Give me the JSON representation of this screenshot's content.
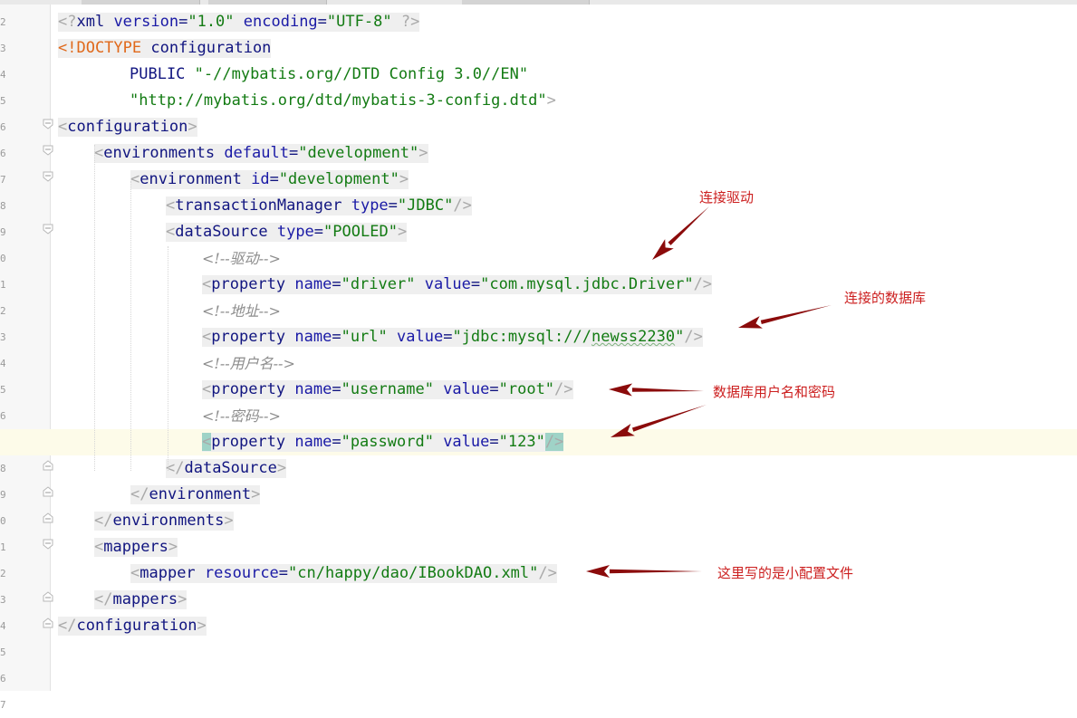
{
  "editor": {
    "lines": [
      {
        "segs": [
          [
            "brk",
            "<?"
          ],
          [
            "nm",
            "xml "
          ],
          [
            "at",
            "version"
          ],
          [
            "eq",
            "="
          ],
          [
            "st",
            "\"1.0\""
          ],
          [
            "pl",
            " "
          ],
          [
            "at",
            "encoding"
          ],
          [
            "eq",
            "="
          ],
          [
            "st",
            "\"UTF-8\""
          ],
          [
            "pl",
            " "
          ],
          [
            "brk",
            "?>"
          ]
        ]
      },
      {
        "segs": [
          [
            "kw",
            "<!DOCTYPE "
          ],
          [
            "nm",
            "configuration"
          ]
        ]
      },
      {
        "segs": [
          [
            "pl",
            "PUBLIC "
          ],
          [
            "st",
            "\"-//mybatis.org//DTD Config 3.0//EN\""
          ]
        ]
      },
      {
        "segs": [
          [
            "st",
            "\"http://mybatis.org/dtd/mybatis-3-config.dtd\""
          ],
          [
            "brk",
            ">"
          ]
        ]
      },
      {
        "segs": [
          [
            "brk",
            "<"
          ],
          [
            "nm",
            "configuration"
          ],
          [
            "brk",
            ">"
          ]
        ]
      },
      {
        "segs": [
          [
            "brk",
            "<"
          ],
          [
            "nm",
            "environments "
          ],
          [
            "at",
            "default"
          ],
          [
            "eq",
            "="
          ],
          [
            "st",
            "\"development\""
          ],
          [
            "brk",
            ">"
          ]
        ]
      },
      {
        "segs": [
          [
            "brk",
            "<"
          ],
          [
            "nm",
            "environment "
          ],
          [
            "at",
            "id"
          ],
          [
            "eq",
            "="
          ],
          [
            "st",
            "\"development\""
          ],
          [
            "brk",
            ">"
          ]
        ]
      },
      {
        "segs": [
          [
            "brk",
            "<"
          ],
          [
            "nm",
            "transactionManager "
          ],
          [
            "at",
            "type"
          ],
          [
            "eq",
            "="
          ],
          [
            "st",
            "\"JDBC\""
          ],
          [
            "brk",
            "/>"
          ]
        ]
      },
      {
        "segs": [
          [
            "brk",
            "<"
          ],
          [
            "nm",
            "dataSource "
          ],
          [
            "at",
            "type"
          ],
          [
            "eq",
            "="
          ],
          [
            "st",
            "\"POOLED\""
          ],
          [
            "brk",
            ">"
          ]
        ]
      },
      {
        "segs": [
          [
            "cm",
            "<!--驱动-->"
          ]
        ]
      },
      {
        "segs": [
          [
            "brk",
            "<"
          ],
          [
            "nm",
            "property "
          ],
          [
            "at",
            "name"
          ],
          [
            "eq",
            "="
          ],
          [
            "st",
            "\"driver\""
          ],
          [
            "pl",
            " "
          ],
          [
            "at",
            "value"
          ],
          [
            "eq",
            "="
          ],
          [
            "st",
            "\"com.mysql.jdbc.Driver\""
          ],
          [
            "brk",
            "/>"
          ]
        ]
      },
      {
        "segs": [
          [
            "cm",
            "<!--地址-->"
          ]
        ]
      },
      {
        "segs": [
          [
            "brk",
            "<"
          ],
          [
            "nm",
            "property "
          ],
          [
            "at",
            "name"
          ],
          [
            "eq",
            "="
          ],
          [
            "st",
            "\"url\""
          ],
          [
            "pl",
            " "
          ],
          [
            "at",
            "value"
          ],
          [
            "eq",
            "="
          ],
          [
            "st",
            "\"jdbc:mysql:///"
          ],
          [
            "st sq",
            "newss2230"
          ],
          [
            "st",
            "\""
          ],
          [
            "brk",
            "/>"
          ]
        ]
      },
      {
        "segs": [
          [
            "cm",
            "<!--用户名-->"
          ]
        ]
      },
      {
        "segs": [
          [
            "brk",
            "<"
          ],
          [
            "nm",
            "property "
          ],
          [
            "at",
            "name"
          ],
          [
            "eq",
            "="
          ],
          [
            "st",
            "\"username\""
          ],
          [
            "pl",
            " "
          ],
          [
            "at",
            "value"
          ],
          [
            "eq",
            "="
          ],
          [
            "st",
            "\"root\""
          ],
          [
            "brk",
            "/>"
          ]
        ]
      },
      {
        "segs": [
          [
            "cm",
            "<!--密码-->"
          ]
        ]
      },
      {
        "segs": [
          [
            "brk hl",
            "<"
          ],
          [
            "nm",
            "property "
          ],
          [
            "at",
            "name"
          ],
          [
            "eq",
            "="
          ],
          [
            "st",
            "\"password\""
          ],
          [
            "pl",
            " "
          ],
          [
            "at",
            "value"
          ],
          [
            "eq",
            "="
          ],
          [
            "st",
            "\"123\""
          ],
          [
            "brk hl",
            "/>"
          ]
        ]
      },
      {
        "segs": [
          [
            "brk",
            "</"
          ],
          [
            "nm",
            "dataSource"
          ],
          [
            "brk",
            ">"
          ]
        ]
      },
      {
        "segs": [
          [
            "brk",
            "</"
          ],
          [
            "nm",
            "environment"
          ],
          [
            "brk",
            ">"
          ]
        ]
      },
      {
        "segs": [
          [
            "brk",
            "</"
          ],
          [
            "nm",
            "environments"
          ],
          [
            "brk",
            ">"
          ]
        ]
      },
      {
        "segs": [
          [
            "brk",
            "<"
          ],
          [
            "nm",
            "mappers"
          ],
          [
            "brk",
            ">"
          ]
        ]
      },
      {
        "segs": [
          [
            "brk",
            "<"
          ],
          [
            "nm",
            "mapper "
          ],
          [
            "at",
            "resource"
          ],
          [
            "eq",
            "="
          ],
          [
            "st",
            "\"cn/happy/dao/IBookDAO.xml\""
          ],
          [
            "brk",
            "/>"
          ]
        ]
      },
      {
        "segs": [
          [
            "brk",
            "</"
          ],
          [
            "nm",
            "mappers"
          ],
          [
            "brk",
            ">"
          ]
        ]
      },
      {
        "segs": [
          [
            "brk",
            "</"
          ],
          [
            "nm",
            "configuration"
          ],
          [
            "brk",
            ">"
          ]
        ]
      }
    ]
  },
  "annotations": {
    "driver": "连接驱动",
    "database": "连接的数据库",
    "credentials": "数据库用户名和密码",
    "mapper": "这里写的是小配置文件"
  },
  "colors": {
    "tag": "#111580",
    "string": "#137b13",
    "doctype": "#e0691b",
    "comment": "#8c8c8c",
    "annotation": "#cc1f1f",
    "arrow": "#8b0b0b",
    "current_line": "#fdfbe9",
    "brace_highlight": "#9fd3c7"
  },
  "gutter": {
    "line_number_fragments": [
      "2",
      "3",
      "4",
      "5",
      "6",
      "6",
      "7",
      "8",
      "9",
      "0",
      "1",
      "2",
      "3",
      "4",
      "5",
      "6",
      "7",
      "8",
      "9",
      "0",
      "1",
      "2",
      "3",
      "4",
      "5",
      "6",
      "7"
    ]
  }
}
